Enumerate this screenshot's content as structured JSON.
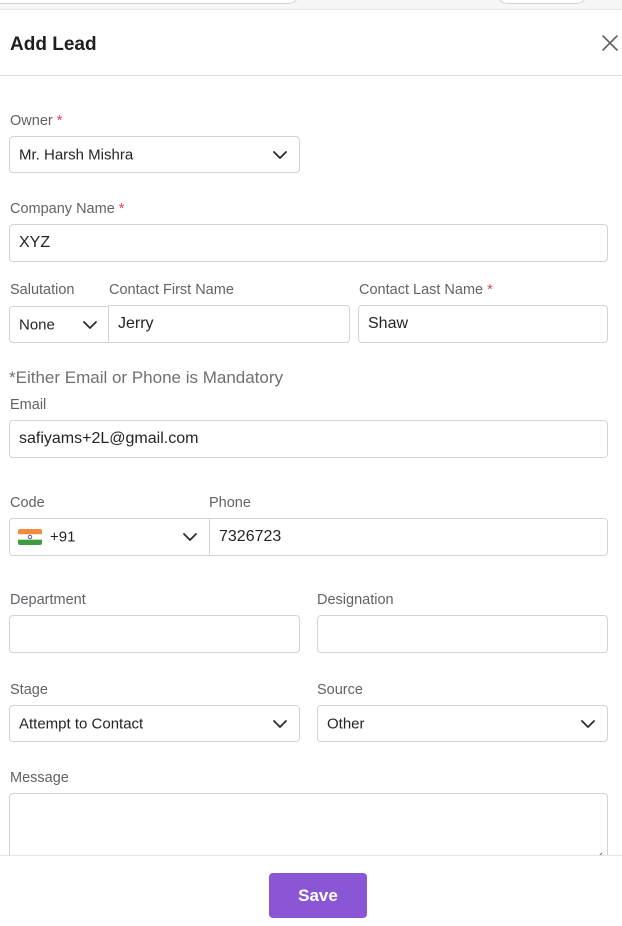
{
  "header": {
    "title": "Add Lead",
    "close_icon": "close-icon"
  },
  "form": {
    "owner": {
      "label": "Owner",
      "required_mark": "*",
      "value": "Mr. Harsh Mishra"
    },
    "company": {
      "label": "Company Name",
      "required_mark": "*",
      "value": "XYZ"
    },
    "salutation": {
      "label": "Salutation",
      "value": "None"
    },
    "first_name": {
      "label": "Contact First Name",
      "value": "Jerry"
    },
    "last_name": {
      "label": "Contact Last Name",
      "required_mark": "*",
      "value": "Shaw"
    },
    "mandatory_note": "*Either Email or Phone is Mandatory",
    "email": {
      "label": "Email",
      "value": "safiyams+2L@gmail.com"
    },
    "code": {
      "label": "Code",
      "value": "+91",
      "flag_icon": "india-flag-icon"
    },
    "phone": {
      "label": "Phone",
      "value": "7326723"
    },
    "department": {
      "label": "Department",
      "value": ""
    },
    "designation": {
      "label": "Designation",
      "value": ""
    },
    "stage": {
      "label": "Stage",
      "value": "Attempt to Contact"
    },
    "source": {
      "label": "Source",
      "value": "Other"
    },
    "message": {
      "label": "Message",
      "value": ""
    }
  },
  "footer": {
    "save_label": "Save"
  },
  "colors": {
    "accent": "#8a56d6",
    "required": "#e5484d",
    "border": "#ced4da"
  }
}
